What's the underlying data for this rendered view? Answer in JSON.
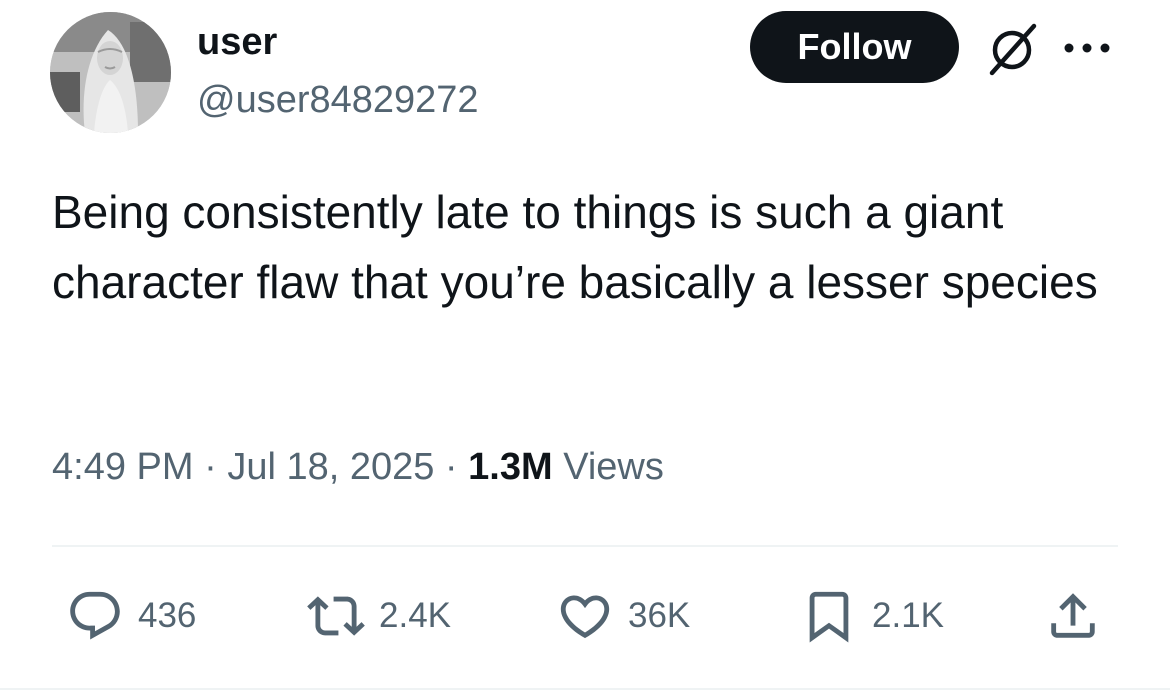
{
  "author": {
    "display_name": "user",
    "handle": "@user84829272",
    "avatar_icon": "avatar-statue-image"
  },
  "follow_label": "Follow",
  "header_icons": [
    "grok-icon",
    "more-icon"
  ],
  "tweet": {
    "text": "Being consistently late to things is such a giant character flaw that you’re basically a lesser species"
  },
  "meta": {
    "time": "4:49 PM",
    "separator1": " · ",
    "date": "Jul 18, 2025",
    "separator2": " · ",
    "views_count": "1.3M",
    "views_label": " Views"
  },
  "actions": {
    "reply_count": "436",
    "repost_count": "2.4K",
    "like_count": "36K",
    "bookmark_count": "2.1K"
  },
  "colors": {
    "text_primary": "#0f1419",
    "text_secondary": "#536471",
    "follow_bg": "#0f1419",
    "divider": "#eff3f4"
  }
}
